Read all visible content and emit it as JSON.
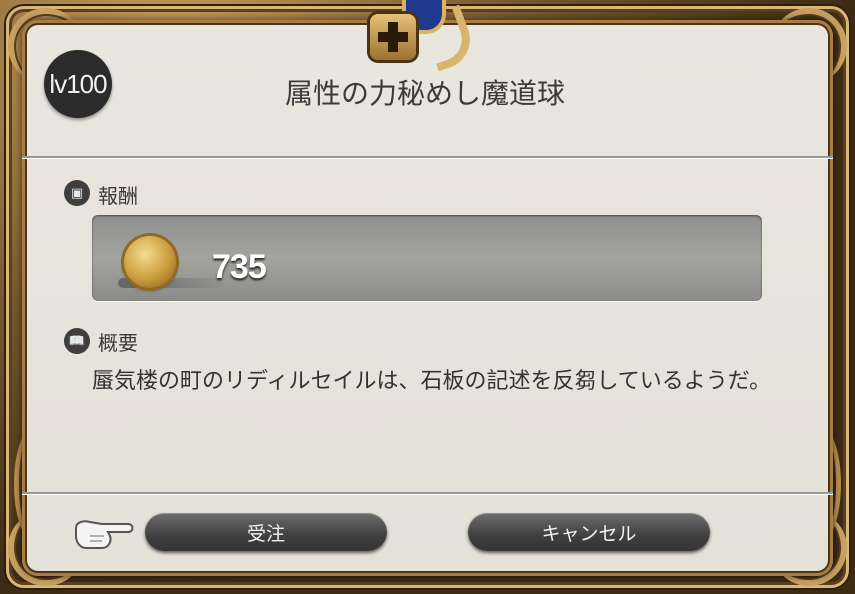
{
  "dialog": {
    "level": "lv100",
    "title": "属性の力秘めし魔道球"
  },
  "reward": {
    "label": "報酬",
    "amount": "735",
    "icon": "gil-coin-icon"
  },
  "summary": {
    "label": "概要",
    "text": "蜃気楼の町のリディルセイルは、石板の記述を反芻しているようだ。"
  },
  "buttons": {
    "accept": "受注",
    "cancel": "キャンセル"
  },
  "colors": {
    "panel": "#e9e6df",
    "frame": "#c8a062",
    "button": "#3f3f3f"
  }
}
